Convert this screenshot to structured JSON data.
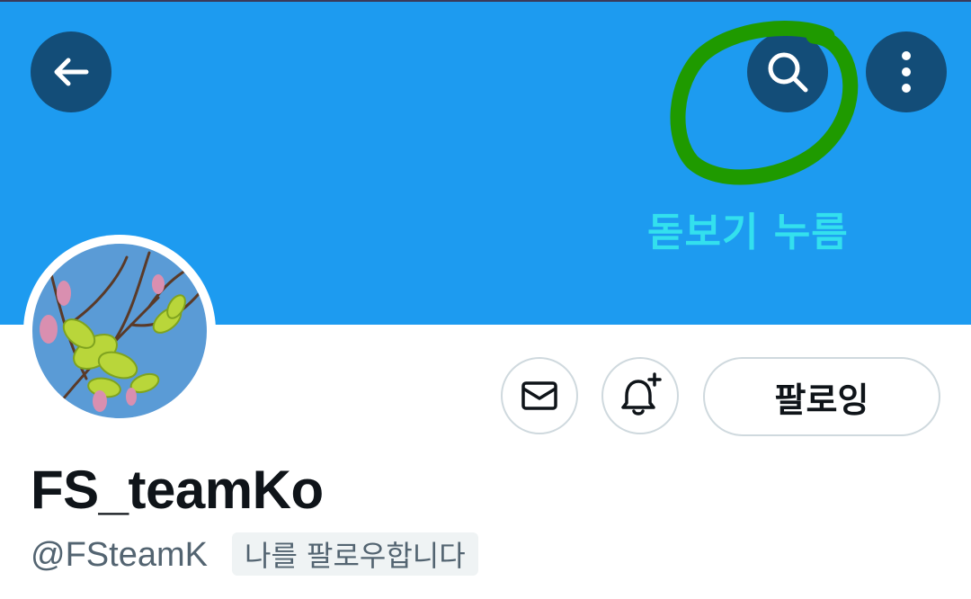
{
  "header": {
    "back_icon": "arrow-left-icon",
    "search_icon": "search-icon",
    "more_icon": "more-vertical-icon"
  },
  "annotation": {
    "text": "돋보기 누름",
    "circle_color": "#1f9a00",
    "text_color": "#33e0ee"
  },
  "profile": {
    "display_name": "FS_teamKo",
    "handle": "@FSteamK",
    "follows_you_badge": "나를 팔로우합니다",
    "avatar": "magnolia-branch-photo"
  },
  "actions": {
    "message_icon": "mail-icon",
    "notify_icon": "bell-plus-icon",
    "follow_label": "팔로잉"
  },
  "colors": {
    "banner": "#1d9bf0",
    "header_button": "#134d78"
  }
}
